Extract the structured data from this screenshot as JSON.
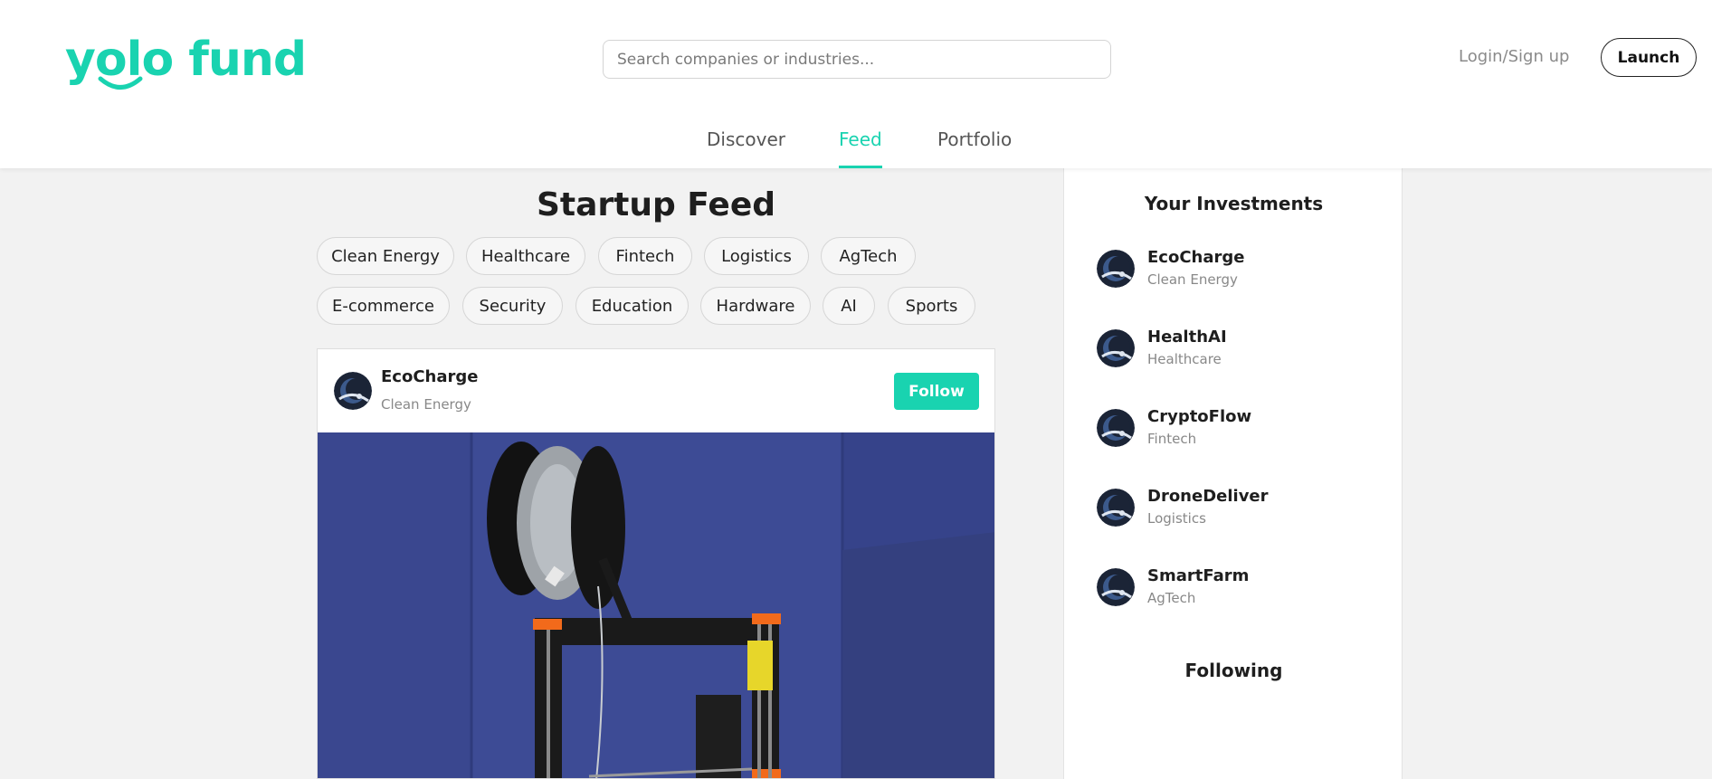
{
  "header": {
    "logo_text": "yolo fund",
    "search": {
      "placeholder": "Search companies or industries..."
    },
    "login_label": "Login/Sign up",
    "launch_label": "Launch"
  },
  "nav": {
    "tabs": [
      {
        "label": "Discover",
        "active": false
      },
      {
        "label": "Feed",
        "active": true
      },
      {
        "label": "Portfolio",
        "active": false
      }
    ]
  },
  "feed": {
    "title": "Startup Feed",
    "categories": [
      "Clean Energy",
      "Healthcare",
      "Fintech",
      "Logistics",
      "AgTech",
      "E-commerce",
      "Security",
      "Education",
      "Hardware",
      "AI",
      "Sports"
    ],
    "post": {
      "company": "EcoCharge",
      "category": "Clean Energy",
      "follow_label": "Follow"
    }
  },
  "sidebar": {
    "investments_title": "Your Investments",
    "investments": [
      {
        "name": "EcoCharge",
        "category": "Clean Energy"
      },
      {
        "name": "HealthAI",
        "category": "Healthcare"
      },
      {
        "name": "CryptoFlow",
        "category": "Fintech"
      },
      {
        "name": "DroneDeliver",
        "category": "Logistics"
      },
      {
        "name": "SmartFarm",
        "category": "AgTech"
      }
    ],
    "following_title": "Following"
  },
  "colors": {
    "accent": "#19d3b0",
    "background": "#f2f2f2"
  }
}
